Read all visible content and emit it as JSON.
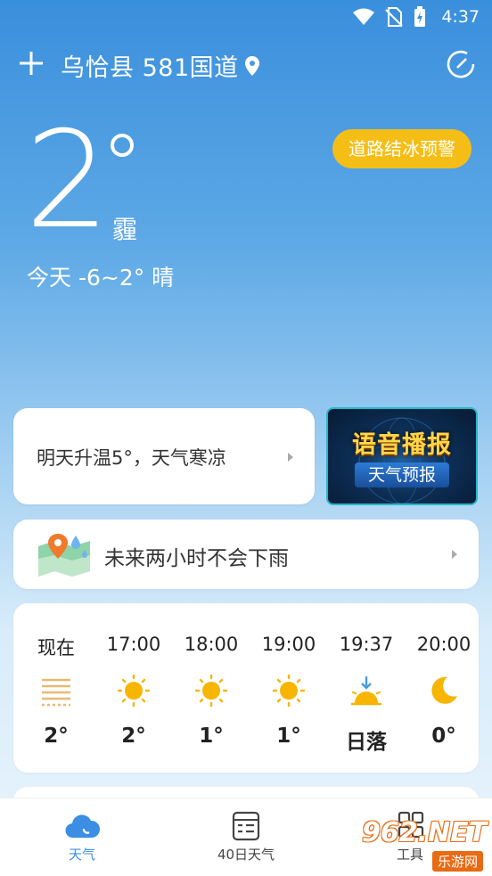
{
  "status": {
    "time": "4:37"
  },
  "header": {
    "location": "乌恰县 581国道"
  },
  "current": {
    "temp": "2",
    "condition": "霾",
    "today": "今天 -6~2°  晴",
    "alert": "道路结冰预警"
  },
  "tomorrow": {
    "text": "明天升温5°，天气寒凉"
  },
  "voice_promo": {
    "title": "语音播报",
    "subtitle": "天气预报"
  },
  "rain": {
    "text": "未来两小时不会下雨"
  },
  "hourly": [
    {
      "time": "现在",
      "icon": "haze-icon",
      "temp": "2°"
    },
    {
      "time": "17:00",
      "icon": "sun-icon",
      "temp": "2°"
    },
    {
      "time": "18:00",
      "icon": "sun-icon",
      "temp": "1°"
    },
    {
      "time": "19:00",
      "icon": "sun-icon",
      "temp": "1°"
    },
    {
      "time": "19:37",
      "icon": "sunset-icon",
      "temp": "日落"
    },
    {
      "time": "20:00",
      "icon": "moon-icon",
      "temp": "0°"
    }
  ],
  "nav": {
    "weather": "天气",
    "forty_day": "40日天气",
    "tools": "工具"
  },
  "watermark": {
    "text": "962.NET",
    "sub": "乐游网"
  },
  "colors": {
    "accent": "#3b8ee3",
    "alert": "#f5be17",
    "sun": "#f7b500"
  }
}
